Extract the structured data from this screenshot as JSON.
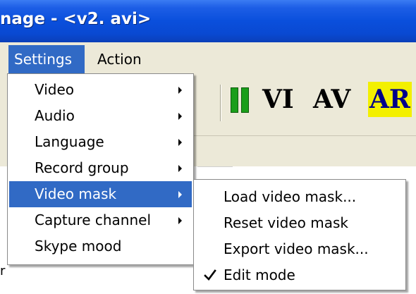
{
  "window": {
    "title": "nage - <v2. avi>"
  },
  "menubar": {
    "items": [
      "Settings",
      "Action"
    ]
  },
  "toolbar": {
    "labels": [
      "VI",
      "AV",
      "AR"
    ]
  },
  "settings_menu": {
    "items": [
      {
        "label": "Video",
        "submenu": true
      },
      {
        "label": "Audio",
        "submenu": true
      },
      {
        "label": "Language",
        "submenu": true
      },
      {
        "label": "Record group",
        "submenu": true
      },
      {
        "label": "Video mask",
        "submenu": true,
        "highlighted": true
      },
      {
        "label": "Capture channel",
        "submenu": true
      },
      {
        "label": "Skype mood",
        "submenu": false
      }
    ]
  },
  "video_mask_submenu": {
    "items": [
      {
        "label": "Load video mask..."
      },
      {
        "label": "Reset video mask"
      },
      {
        "label": "Export video mask..."
      },
      {
        "label": "Edit mode",
        "checked": true
      }
    ]
  },
  "edge_text": "r",
  "colors": {
    "highlight": "#316ac5",
    "title_bar": "#0a4fdc",
    "pause_green": "#1a9e1a",
    "ar_highlight": "#f3f000"
  }
}
